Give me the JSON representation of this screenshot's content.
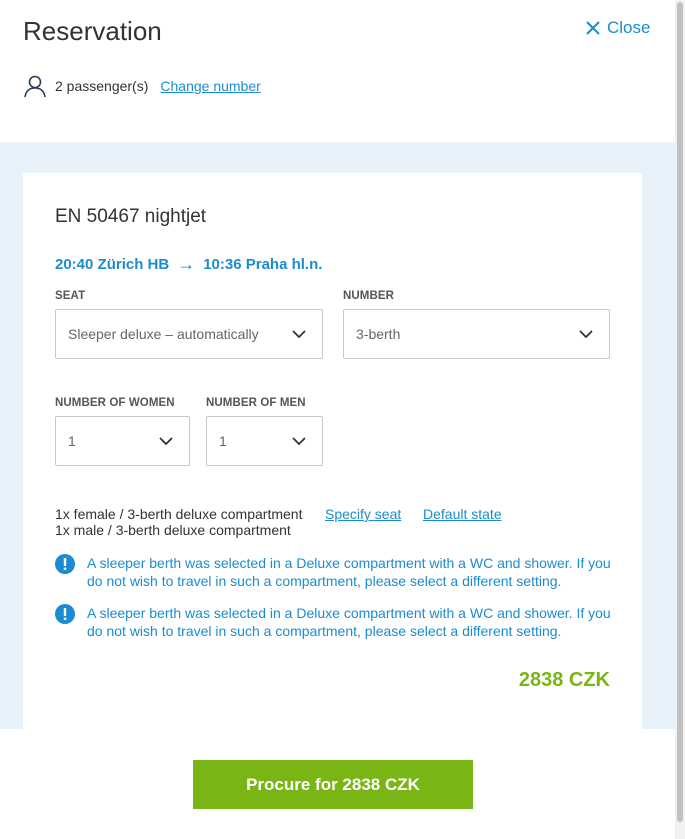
{
  "header": {
    "title": "Reservation",
    "close_label": "Close",
    "passengers_text": "2 passenger(s)",
    "change_number_label": "Change number"
  },
  "train": {
    "name": "EN 50467 nightjet",
    "departure": "20:40 Zürich HB",
    "arrival": "10:36 Praha hl.n."
  },
  "form": {
    "seat_label": "SEAT",
    "seat_value": "Sleeper deluxe – automatically",
    "number_label": "NUMBER",
    "number_value": "3-berth",
    "women_label": "NUMBER OF WOMEN",
    "women_value": "1",
    "men_label": "NUMBER OF MEN",
    "men_value": "1"
  },
  "compartments": {
    "line1": "1x female / 3-berth deluxe compartment",
    "line2": "1x male / 3-berth deluxe compartment",
    "specify_seat_label": "Specify seat",
    "default_state_label": "Default state"
  },
  "notices": [
    "A sleeper berth was selected in a Deluxe compartment with a WC and shower. If you do not wish to travel in such a compartment, please select a different setting.",
    "A sleeper berth was selected in a Deluxe compartment with a WC and shower. If you do not wish to travel in such a compartment, please select a different setting."
  ],
  "price": "2838 CZK",
  "procure_label": "Procure for 2838 CZK",
  "colors": {
    "accent_blue": "#1b8ccf",
    "accent_green": "#79b615",
    "panel_bg": "#e7f1fa"
  },
  "icons": [
    "close-icon",
    "user-icon",
    "chevron-down-icon",
    "info-icon"
  ]
}
